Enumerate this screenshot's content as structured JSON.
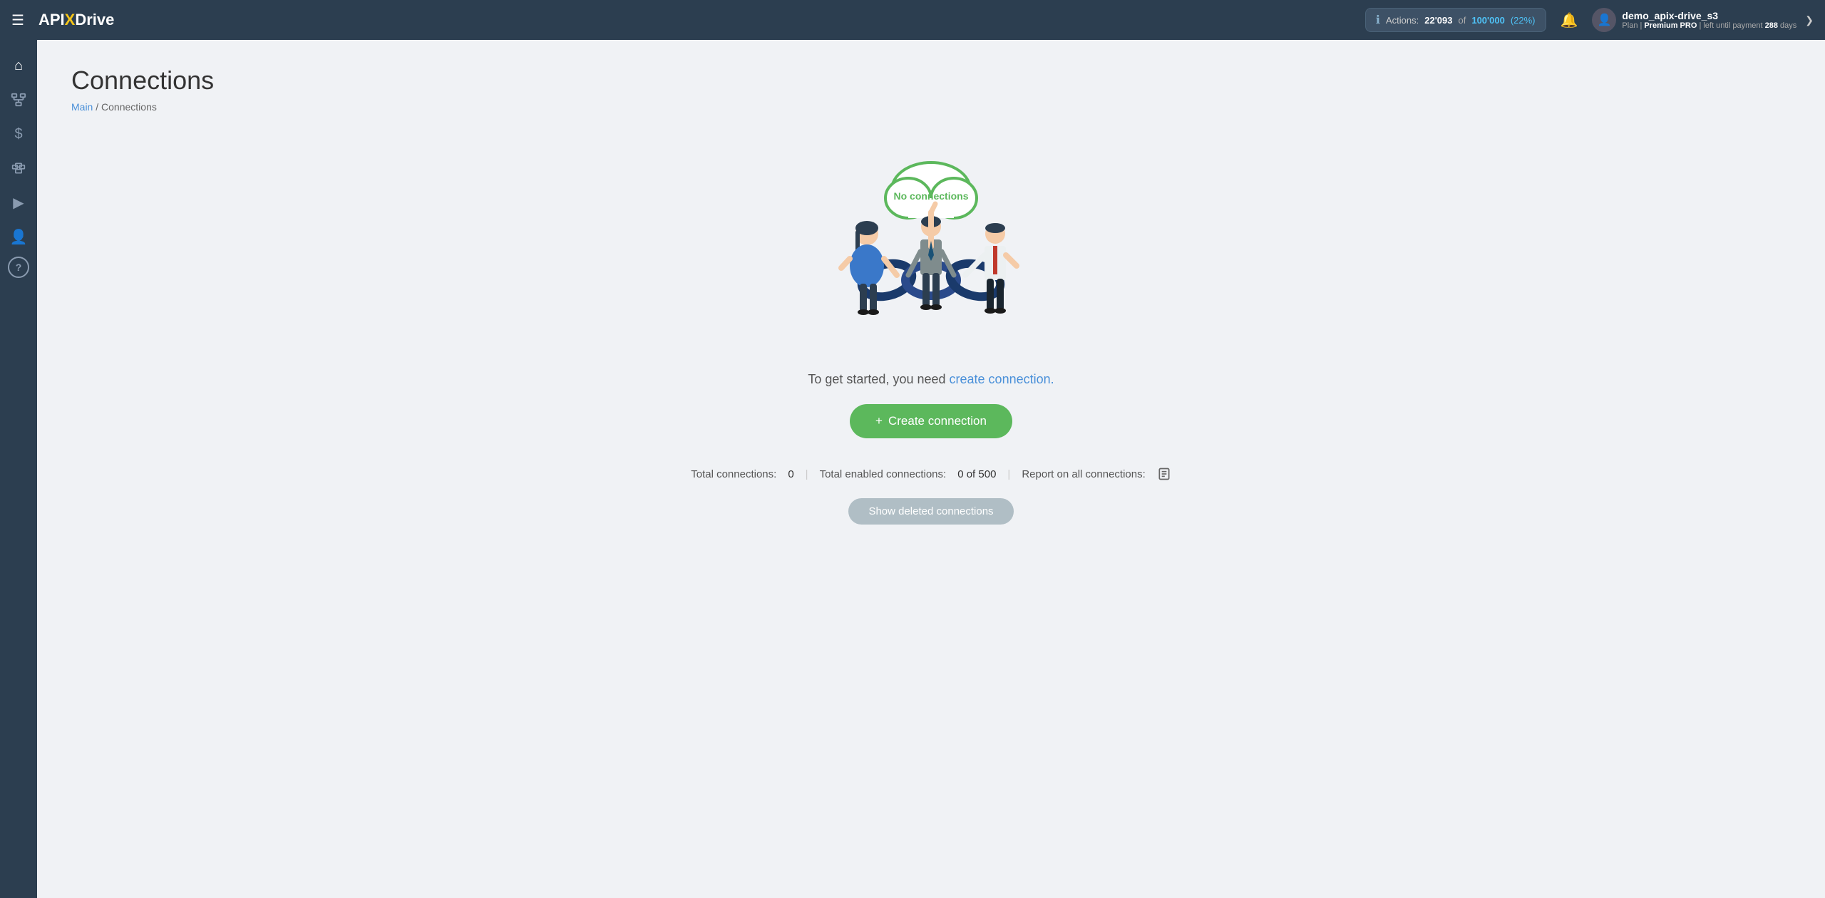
{
  "topnav": {
    "menu_icon": "☰",
    "logo": {
      "api": "API",
      "x": "X",
      "drive": "Drive"
    },
    "actions": {
      "label": "Actions:",
      "used": "22'093",
      "of_text": "of",
      "total": "100'000",
      "pct": "(22%)"
    },
    "bell_icon": "🔔",
    "user": {
      "name": "demo_apix-drive_s3",
      "plan_label": "Plan |",
      "plan_name": "Premium PRO",
      "plan_suffix": "| left until payment",
      "days": "288",
      "days_suffix": "days"
    },
    "chevron": "❯"
  },
  "sidebar": {
    "items": [
      {
        "id": "home",
        "icon": "⌂",
        "label": "Home"
      },
      {
        "id": "connections",
        "icon": "⋮⋮",
        "label": "Connections"
      },
      {
        "id": "billing",
        "icon": "$",
        "label": "Billing"
      },
      {
        "id": "tools",
        "icon": "🧰",
        "label": "Tools"
      },
      {
        "id": "video",
        "icon": "▶",
        "label": "Video"
      },
      {
        "id": "account",
        "icon": "👤",
        "label": "Account"
      },
      {
        "id": "help",
        "icon": "?",
        "label": "Help"
      }
    ]
  },
  "page": {
    "title": "Connections",
    "breadcrumb_home": "Main",
    "breadcrumb_sep": "/",
    "breadcrumb_current": "Connections",
    "illustration_cloud_text": "No connections",
    "empty_text_prefix": "To get started, you need",
    "empty_text_link": "create connection.",
    "create_btn_icon": "+",
    "create_btn_label": "Create connection",
    "stats": {
      "total_label": "Total connections:",
      "total_value": "0",
      "enabled_label": "Total enabled connections:",
      "enabled_value": "0 of 500",
      "report_label": "Report on all connections:"
    },
    "show_deleted_label": "Show deleted connections"
  }
}
